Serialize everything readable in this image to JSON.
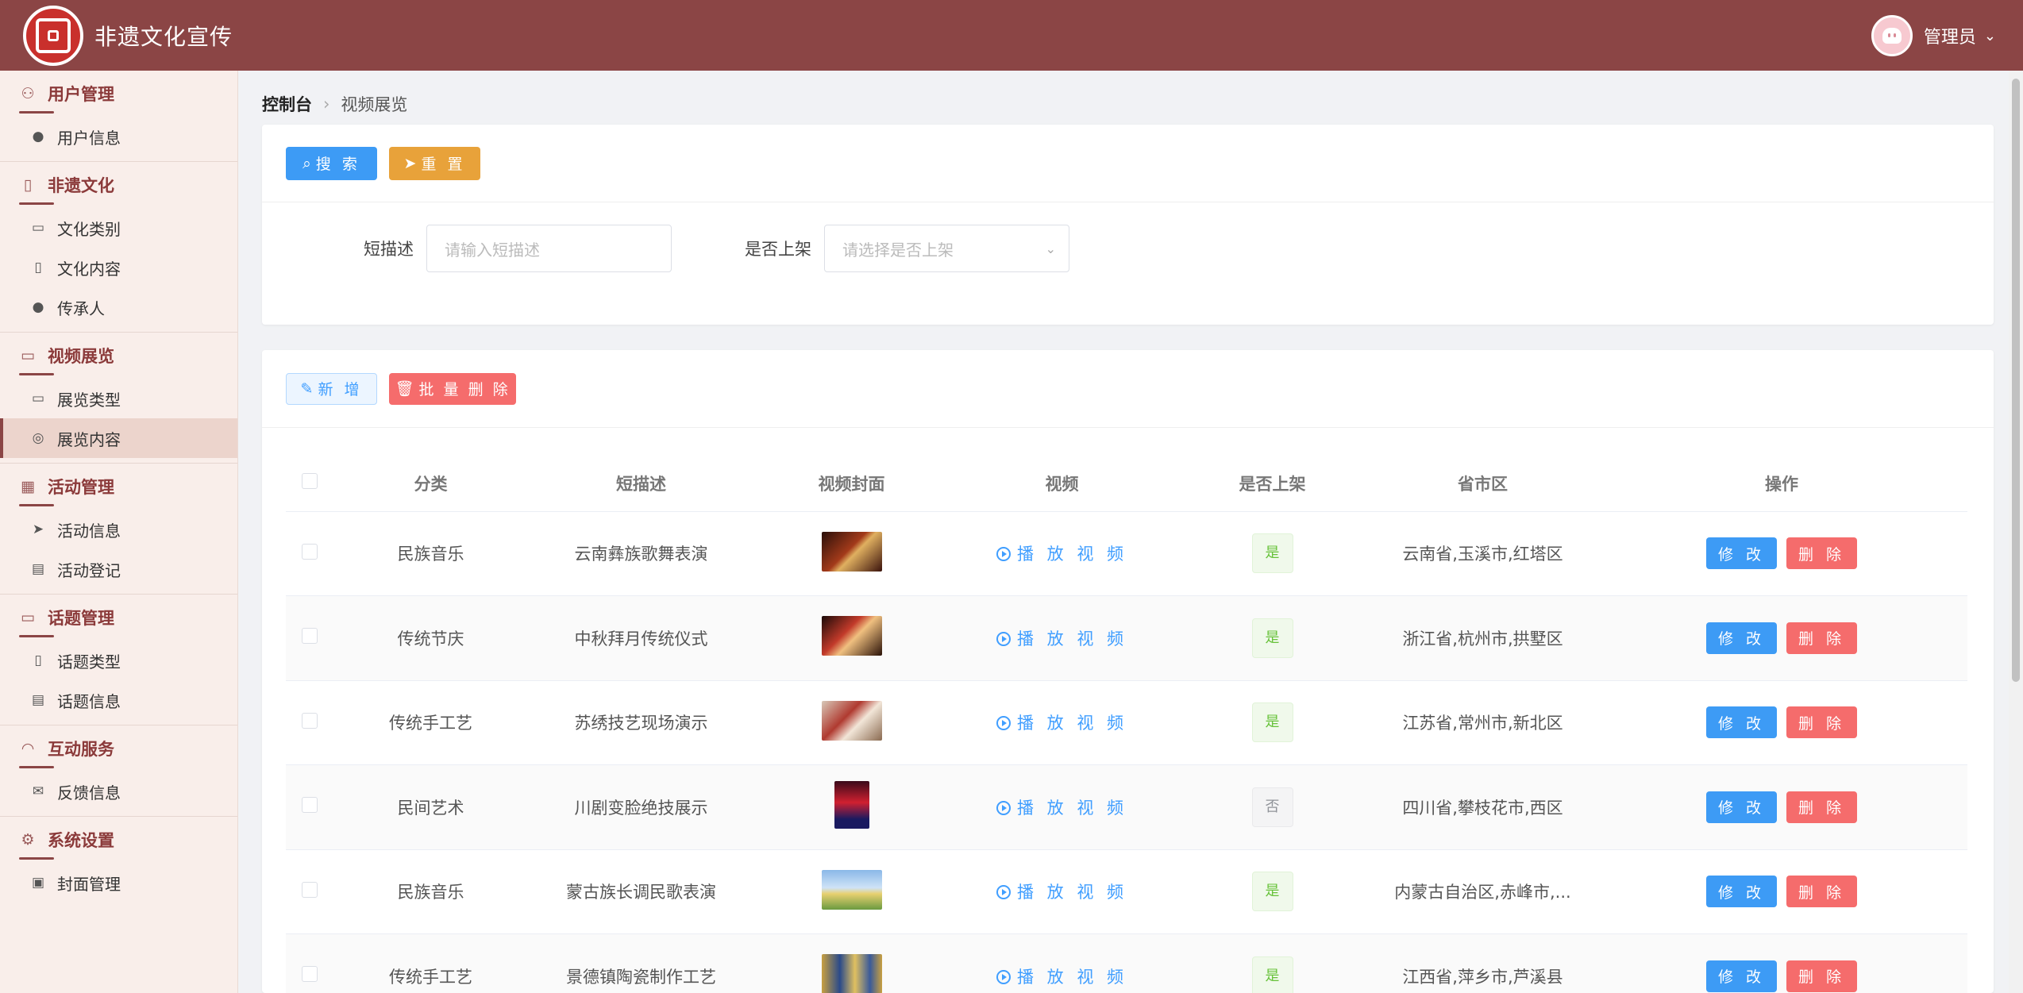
{
  "app": {
    "title": "非遗文化宣传"
  },
  "user": {
    "name": "管理员"
  },
  "sidebar": {
    "groups": [
      {
        "label": "用户管理",
        "icon": "user-icon",
        "items": [
          {
            "label": "用户信息",
            "icon": "person-icon"
          }
        ]
      },
      {
        "label": "非遗文化",
        "icon": "book-icon",
        "items": [
          {
            "label": "文化类别",
            "icon": "folder-icon"
          },
          {
            "label": "文化内容",
            "icon": "open-book-icon"
          },
          {
            "label": "传承人",
            "icon": "person-icon"
          }
        ]
      },
      {
        "label": "视频展览",
        "icon": "video-icon",
        "items": [
          {
            "label": "展览类型",
            "icon": "folder-open-icon"
          },
          {
            "label": "展览内容",
            "icon": "play-circle-icon"
          }
        ]
      },
      {
        "label": "活动管理",
        "icon": "calendar-icon",
        "items": [
          {
            "label": "活动信息",
            "icon": "send-icon"
          },
          {
            "label": "活动登记",
            "icon": "document-icon"
          }
        ]
      },
      {
        "label": "话题管理",
        "icon": "chat-icon",
        "items": [
          {
            "label": "话题类型",
            "icon": "bookmark-icon"
          },
          {
            "label": "话题信息",
            "icon": "message-icon"
          }
        ]
      },
      {
        "label": "互动服务",
        "icon": "headset-icon",
        "items": [
          {
            "label": "反馈信息",
            "icon": "mail-icon"
          }
        ]
      },
      {
        "label": "系统设置",
        "icon": "gear-icon",
        "items": [
          {
            "label": "封面管理",
            "icon": "image-icon"
          }
        ]
      }
    ]
  },
  "breadcrumb": {
    "home": "控制台",
    "current": "视频展览"
  },
  "search": {
    "search_label": "搜 索",
    "reset_label": "重 置",
    "desc_label": "短描述",
    "desc_placeholder": "请输入短描述",
    "listed_label": "是否上架",
    "listed_placeholder": "请选择是否上架"
  },
  "toolbar": {
    "add_label": "新 增",
    "batch_delete_label": "批 量 删 除"
  },
  "table": {
    "headers": [
      "分类",
      "短描述",
      "视频封面",
      "视频",
      "是否上架",
      "省市区",
      "操作"
    ],
    "play_label": "播 放 视 频",
    "edit_label": "修 改",
    "delete_label": "删 除",
    "rows": [
      {
        "category": "民族音乐",
        "desc": "云南彝族歌舞表演",
        "listed": "是",
        "region": "云南省,玉溪市,红塔区"
      },
      {
        "category": "传统节庆",
        "desc": "中秋拜月传统仪式",
        "listed": "是",
        "region": "浙江省,杭州市,拱墅区"
      },
      {
        "category": "传统手工艺",
        "desc": "苏绣技艺现场演示",
        "listed": "是",
        "region": "江苏省,常州市,新北区"
      },
      {
        "category": "民间艺术",
        "desc": "川剧变脸绝技展示",
        "listed": "否",
        "region": "四川省,攀枝花市,西区"
      },
      {
        "category": "民族音乐",
        "desc": "蒙古族长调民歌表演",
        "listed": "是",
        "region": "内蒙古自治区,赤峰市,..."
      },
      {
        "category": "传统手工艺",
        "desc": "景德镇陶瓷制作工艺",
        "listed": "是",
        "region": "江西省,萍乡市,芦溪县"
      }
    ]
  }
}
